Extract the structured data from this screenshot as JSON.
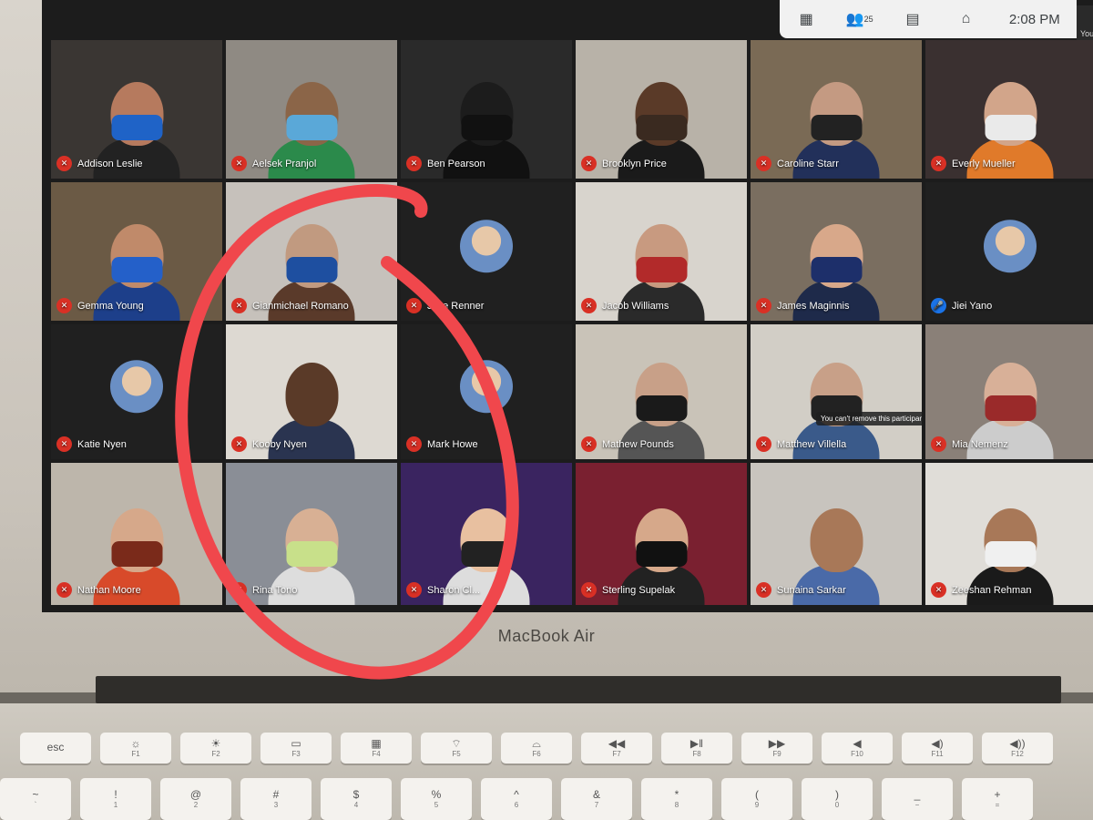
{
  "topbar": {
    "grid_icon": "grid-layout-icon",
    "people_icon": "people-icon",
    "participant_count": "25",
    "chat_icon": "chat-icon",
    "activities_icon": "activities-icon",
    "time": "2:08 PM"
  },
  "self_view": {
    "label": "You"
  },
  "participants": [
    {
      "name": "Addison Leslie",
      "bg": "#3a3633",
      "skin": "#b67a5e",
      "mask": "#1f63c7",
      "shirt": "#222"
    },
    {
      "name": "Aelsek Pranjol",
      "bg": "#8f8a83",
      "skin": "#8b6548",
      "mask": "#5aa8d8",
      "shirt": "#2b8a4b"
    },
    {
      "name": "Ben Pearson",
      "bg": "#2a2a2a",
      "skin": "#1c1c1c",
      "mask": "#111",
      "shirt": "#111"
    },
    {
      "name": "Brooklyn Price",
      "bg": "#b8b2a8",
      "skin": "#5a3a28",
      "mask": "#3a2a20",
      "shirt": "#1a1a1a"
    },
    {
      "name": "Caroline Starr",
      "bg": "#7a6a55",
      "skin": "#c49a82",
      "mask": "#222",
      "shirt": "#22305a"
    },
    {
      "name": "Everly Mueller",
      "bg": "#3a3030",
      "skin": "#d2a58a",
      "mask": "#eaeaea",
      "shirt": "#e07a2a"
    },
    {
      "name": "Gemma Young",
      "bg": "#6b5a45",
      "skin": "#c08a6a",
      "mask": "#2460c9",
      "shirt": "#1d3f8a"
    },
    {
      "name": "Gianmichael Romano",
      "bg": "#c6c1bb",
      "skin": "#c19a80",
      "mask": "#1e4fa0",
      "shirt": "#5a3a2a"
    },
    {
      "name": "Jace Renner",
      "bg": "#202020",
      "avatar": true
    },
    {
      "name": "Jacob Williams",
      "bg": "#d8d4cd",
      "skin": "#c89a80",
      "mask": "#b22a2a",
      "shirt": "#2a2a2a"
    },
    {
      "name": "James Maginnis",
      "bg": "#7a6e60",
      "skin": "#d8a88a",
      "mask": "#1d2f6a",
      "shirt": "#1e2a4a"
    },
    {
      "name": "Jiei Yano",
      "bg": "#202020",
      "avatar": true,
      "mic": "blue"
    },
    {
      "name": "Katie Nyen",
      "bg": "#202020",
      "avatar": true
    },
    {
      "name": "Kooby Nyen",
      "bg": "#ddd9d2",
      "skin": "#5a3a28",
      "mask": "",
      "shirt": "#2a3450"
    },
    {
      "name": "Mark Howe",
      "bg": "#202020",
      "avatar": true
    },
    {
      "name": "Mathew Pounds",
      "bg": "#c9c3b8",
      "skin": "#c8a088",
      "mask": "#1a1a1a",
      "shirt": "#555"
    },
    {
      "name": "Matthew Villella",
      "bg": "#d2cec6",
      "skin": "#c8a088",
      "mask": "#222",
      "shirt": "#3a5a8a",
      "tooltip": "You can't remove this participant"
    },
    {
      "name": "Mia Nemenz",
      "bg": "#8a8078",
      "skin": "#d8b098",
      "mask": "#9a2a2a",
      "shirt": "#ccc"
    },
    {
      "name": "Nathan Moore",
      "bg": "#bdb6ab",
      "skin": "#d6a88a",
      "mask": "#7a2a1a",
      "shirt": "#d84a2a"
    },
    {
      "name": "Rina Tono",
      "bg": "#8a8e96",
      "skin": "#d8b094",
      "mask": "#c8e08a",
      "shirt": "#ddd"
    },
    {
      "name": "Sharon Cl...",
      "bg": "#3a2460",
      "skin": "#e8c0a0",
      "mask": "#222",
      "shirt": "#ddd"
    },
    {
      "name": "Sterling Supelak",
      "bg": "#7a2030",
      "skin": "#d6a88a",
      "mask": "#111",
      "shirt": "#222"
    },
    {
      "name": "Sunaina Sarkar",
      "bg": "#c8c4be",
      "skin": "#a87858",
      "mask": "",
      "shirt": "#4a6aa8"
    },
    {
      "name": "Zeeshan Rehman",
      "bg": "#e0ddd8",
      "skin": "#a87858",
      "mask": "#f0f0f0",
      "shirt": "#1a1a1a"
    }
  ],
  "laptop": {
    "brand": "MacBook Air"
  },
  "keyboard": {
    "fn_row": [
      {
        "main": "esc",
        "sub": ""
      },
      {
        "main": "☼",
        "sub": "F1"
      },
      {
        "main": "☀",
        "sub": "F2"
      },
      {
        "main": "▭",
        "sub": "F3"
      },
      {
        "main": "▦",
        "sub": "F4"
      },
      {
        "main": "⌔",
        "sub": "F5"
      },
      {
        "main": "⌓",
        "sub": "F6"
      },
      {
        "main": "◀◀",
        "sub": "F7"
      },
      {
        "main": "▶‖",
        "sub": "F8"
      },
      {
        "main": "▶▶",
        "sub": "F9"
      },
      {
        "main": "◀",
        "sub": "F10"
      },
      {
        "main": "◀)",
        "sub": "F11"
      },
      {
        "main": "◀))",
        "sub": "F12"
      }
    ],
    "num_row": [
      {
        "main": "~",
        "sub": "`"
      },
      {
        "main": "!",
        "sub": "1"
      },
      {
        "main": "@",
        "sub": "2"
      },
      {
        "main": "#",
        "sub": "3"
      },
      {
        "main": "$",
        "sub": "4"
      },
      {
        "main": "%",
        "sub": "5"
      },
      {
        "main": "^",
        "sub": "6"
      },
      {
        "main": "&",
        "sub": "7"
      },
      {
        "main": "*",
        "sub": "8"
      },
      {
        "main": "(",
        "sub": "9"
      },
      {
        "main": ")",
        "sub": "0"
      },
      {
        "main": "_",
        "sub": "−"
      },
      {
        "main": "+",
        "sub": "="
      }
    ]
  },
  "colors": {
    "annotation": "#f0474c",
    "mic_muted": "#d93025",
    "mic_active": "#1a73e8"
  }
}
